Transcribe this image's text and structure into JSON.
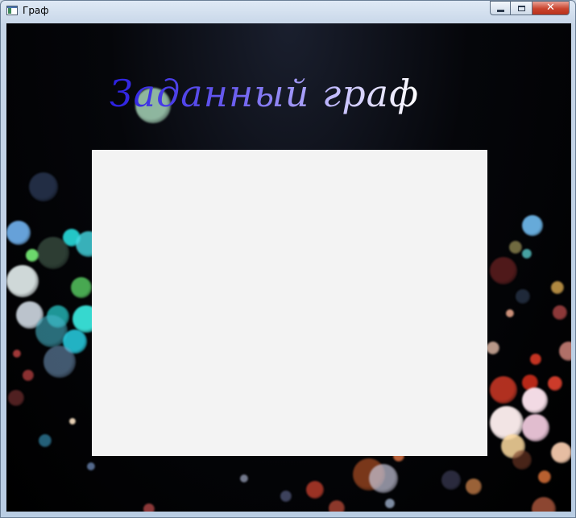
{
  "window": {
    "title": "Граф",
    "minimize_icon": "minimize-icon",
    "maximize_icon": "maximize-icon",
    "close_icon": "close-icon",
    "close_glyph": "✕"
  },
  "main": {
    "heading": "Заданный граф",
    "graph_panel_color": "#f3f3f3"
  },
  "colors": {
    "heading_gradient_start": "#2a1fe0",
    "heading_gradient_end": "#ffffff",
    "close_button": "#c9442e"
  }
}
